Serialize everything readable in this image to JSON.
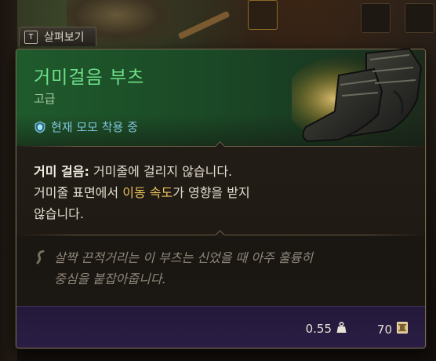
{
  "inspect": {
    "key": "T",
    "label": "살펴보기"
  },
  "item": {
    "name": "거미걸음 부츠",
    "rarity": "고급",
    "status": "현재 모모 착용 중",
    "name_color": "#6fe08a",
    "status_color": "#7fc4d9"
  },
  "description": {
    "ability_name": "거미 걸음:",
    "line1_rest": " 거미줄에 걸리지 않습니다.",
    "line2_pre": "거미줄 표면에서 ",
    "keyword": "이동 속도",
    "line2_post": "가 영향을 받지",
    "line3": "않습니다.",
    "keyword_color": "#e9c25d"
  },
  "flavor": {
    "line1": "살짝 끈적거리는 이 부츠는 신었을 때 아주 훌륭히",
    "line2": "중심을 붙잡아줍니다."
  },
  "footer": {
    "weight": "0.55",
    "price": "70",
    "weight_icon": "weight-icon",
    "price_icon": "gold-coin-icon"
  }
}
